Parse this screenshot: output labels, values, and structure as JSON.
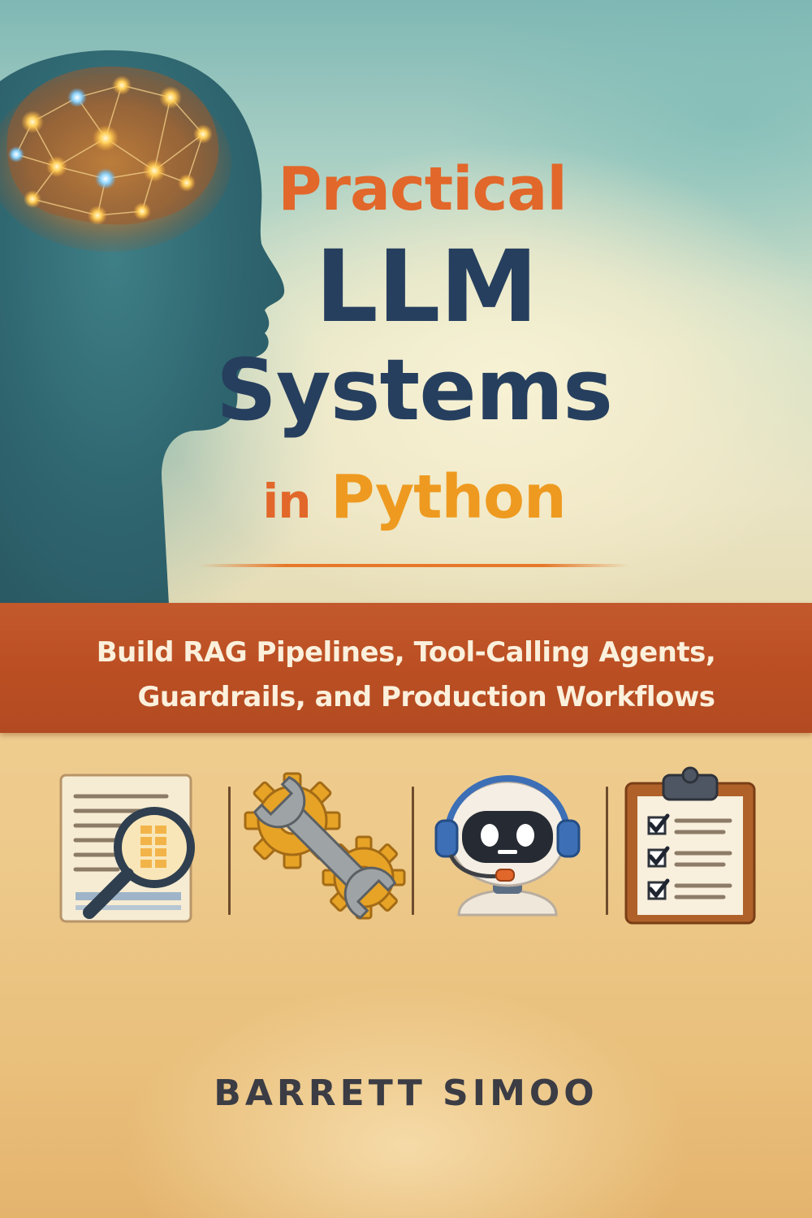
{
  "cover": {
    "title_line_1": "Practical",
    "title_line_2": "LLM",
    "title_line_3": "Systems",
    "title_word_in": "in",
    "title_word_python": "Python",
    "subtitle_line_1": "Build RAG Pipelines, Tool-Calling Agents,",
    "subtitle_line_2": "Guardrails, and Production Workflows",
    "author": "BARRETT SIMOO"
  },
  "icons": {
    "items": [
      "document-search-icon",
      "gears-wrench-icon",
      "robot-headset-icon",
      "clipboard-checklist-icon"
    ]
  },
  "colors": {
    "title_orange": "#e2672a",
    "title_navy": "#263f5e",
    "python_amber": "#ee9a20",
    "band_rust": "#bb4f23",
    "subtitle_cream": "#fbf0dc",
    "author_gray": "#3b3c44"
  }
}
